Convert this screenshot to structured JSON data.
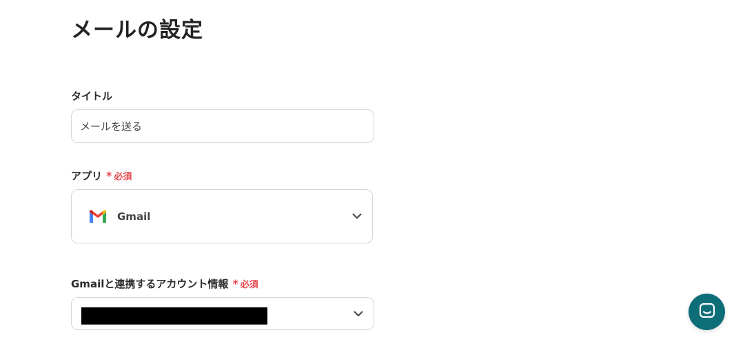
{
  "page": {
    "title": "メールの設定"
  },
  "form": {
    "title_field": {
      "label": "タイトル",
      "value": "メールを送る"
    },
    "app_field": {
      "label": "アプリ",
      "required_mark": "*",
      "required_text": "必須",
      "selected_app": "Gmail",
      "icon": "gmail-icon"
    },
    "account_field": {
      "label": "Gmailと連携するアカウント情報",
      "required_mark": "*",
      "required_text": "必須",
      "value_redacted": true
    }
  },
  "chat_widget": {
    "icon": "chat-icon",
    "color": "#0d6e78"
  },
  "colors": {
    "required": "#e5484d",
    "border": "#d6d6d6",
    "accent": "#0d6e78"
  }
}
